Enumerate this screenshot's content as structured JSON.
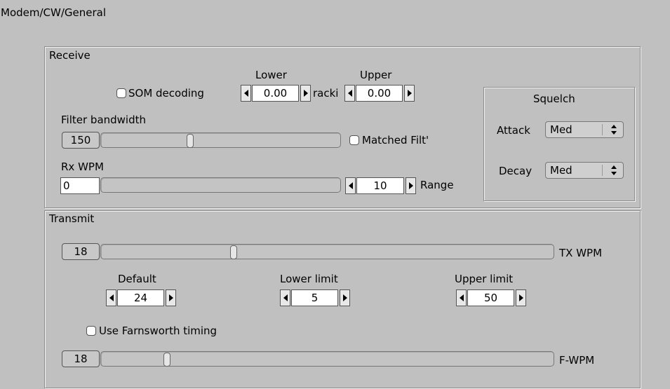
{
  "breadcrumb": "Modem/CW/General",
  "receive": {
    "title": "Receive",
    "som_label": "SOM decoding",
    "lower_label": "Lower",
    "upper_label": "Upper",
    "lower_value": "0.00",
    "tracking_label": "racki",
    "upper_value": "0.00",
    "filter_bandwidth_label": "Filter bandwidth",
    "filter_bandwidth_value": "150",
    "filter_bandwidth_level": 0.37,
    "matched_filter_label": "Matched Filt'",
    "rx_wpm_label": "Rx WPM",
    "rx_wpm_value": "0",
    "range_value": "10",
    "range_label": "Range"
  },
  "squelch": {
    "title": "Squelch",
    "attack_label": "Attack",
    "attack_value": "Med",
    "decay_label": "Decay",
    "decay_value": "Med"
  },
  "transmit": {
    "title": "Transmit",
    "tx_wpm_value": "18",
    "tx_wpm_label": "TX WPM",
    "tx_wpm_level": 0.29,
    "default_label": "Default",
    "default_value": "24",
    "lower_limit_label": "Lower limit",
    "lower_limit_value": "5",
    "upper_limit_label": "Upper limit",
    "upper_limit_value": "50",
    "farnsworth_label": "Use Farnsworth timing",
    "fwpm_value": "18",
    "fwpm_label": "F-WPM",
    "fwpm_level": 0.14
  }
}
